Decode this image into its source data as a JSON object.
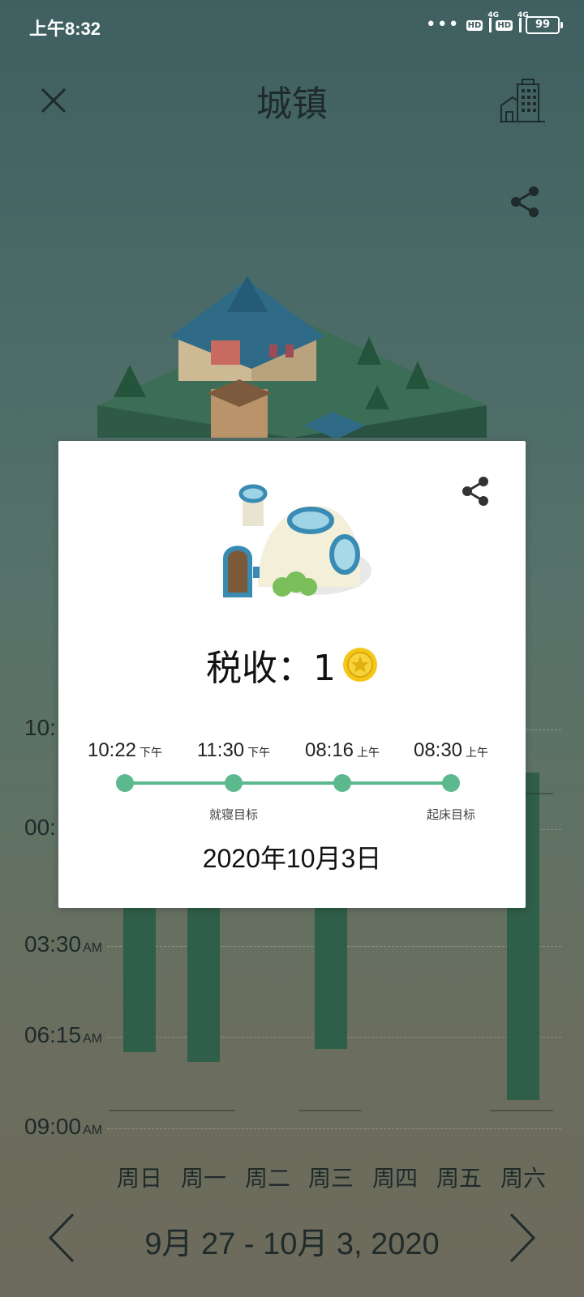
{
  "status_bar": {
    "time": "上午8:32",
    "dots": "•••",
    "hd_label": "HD",
    "network": "4G",
    "battery": "99"
  },
  "header": {
    "title": "城镇",
    "close_icon": "close-icon",
    "city_icon": "city-buildings-icon",
    "share_icon": "share-icon"
  },
  "chart_data": {
    "type": "bar",
    "title": "",
    "y_tick_labels": [
      {
        "time": "10:",
        "suffix": ""
      },
      {
        "time": "00:",
        "suffix": ""
      },
      {
        "time": "03:30",
        "suffix": "AM"
      },
      {
        "time": "06:15",
        "suffix": "AM"
      },
      {
        "time": "09:00",
        "suffix": "AM"
      }
    ],
    "categories": [
      "周日",
      "周一",
      "周二",
      "周三",
      "周四",
      "周五",
      "周六"
    ],
    "ylim_hours_from_9pm": [
      0,
      12
    ],
    "bars": [
      {
        "day": "周日",
        "start": 2.8,
        "end": 9.7
      },
      {
        "day": "周一",
        "start": 2.8,
        "end": 10.0
      },
      {
        "day": "周二",
        "start": null,
        "end": null
      },
      {
        "day": "周三",
        "start": 2.8,
        "end": 9.6
      },
      {
        "day": "周四",
        "start": null,
        "end": null
      },
      {
        "day": "周五",
        "start": null,
        "end": null
      },
      {
        "day": "周六",
        "start": 1.3,
        "end": 11.15
      }
    ],
    "bar_color": "#2f5e49"
  },
  "navigation": {
    "prev_icon": "chevron-left-icon",
    "next_icon": "chevron-right-icon",
    "date_range": "9月 27 - 10月 3, 2020"
  },
  "popup": {
    "share_icon": "share-icon",
    "house_icon": "dome-house-icon",
    "tax_label": "税收：1",
    "coin_icon": "coin-icon",
    "timeline": [
      {
        "time": "10:22",
        "period": "下午",
        "note": ""
      },
      {
        "time": "11:30",
        "period": "下午",
        "note": "就寝目标"
      },
      {
        "time": "08:16",
        "period": "上午",
        "note": ""
      },
      {
        "time": "08:30",
        "period": "上午",
        "note": "起床目标"
      }
    ],
    "date": "2020年10月3日",
    "accent_color": "#5cb88d"
  }
}
